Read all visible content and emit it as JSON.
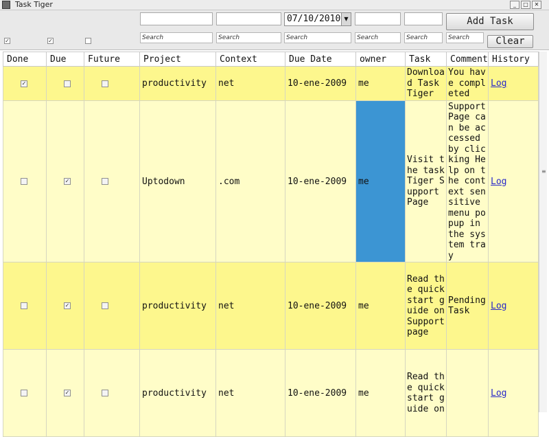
{
  "window": {
    "title": "Task Tiger",
    "minimize": "_",
    "maximize": "□",
    "close": "✕"
  },
  "filters": {
    "date_value": "07/10/2010",
    "search_placeholders": [
      "Search",
      "Search",
      "Search",
      "Search",
      "Search",
      "Search"
    ],
    "checkbox_marks": [
      "✓",
      "✓",
      ""
    ],
    "add_task_label": "Add Task",
    "clear_label": "Clear"
  },
  "table": {
    "headers": [
      "Done",
      "Due",
      "Future",
      "Project",
      "Context",
      "Due Date",
      "owner",
      "Task",
      "Comment",
      "History"
    ],
    "rows": [
      {
        "done": "✓",
        "due": "",
        "future": "",
        "project": "productivity",
        "context": "net",
        "due_date": "10-ene-2009",
        "owner": "me",
        "task": "Download Task Tiger",
        "comment": "You have completed",
        "history": "Log"
      },
      {
        "done": "",
        "due": "✓",
        "future": "",
        "project": "Uptodown",
        "context": ".com",
        "due_date": "10-ene-2009",
        "owner": "me",
        "task": "Visit the taskTiger Support Page",
        "comment": "Support Page can be accessed by clicking Help on the context sensitive menu popup in the system tray",
        "history": "Log"
      },
      {
        "done": "",
        "due": "✓",
        "future": "",
        "project": "productivity",
        "context": "net",
        "due_date": "10-ene-2009",
        "owner": "me",
        "task": "Read the quick start guide on Support page",
        "comment": "Pending Task",
        "history": "Log"
      },
      {
        "done": "",
        "due": "✓",
        "future": "",
        "project": "productivity",
        "context": "net",
        "due_date": "10-ene-2009",
        "owner": "me",
        "task": "Read the quick start guide on",
        "comment": "",
        "history": "Log"
      }
    ]
  }
}
